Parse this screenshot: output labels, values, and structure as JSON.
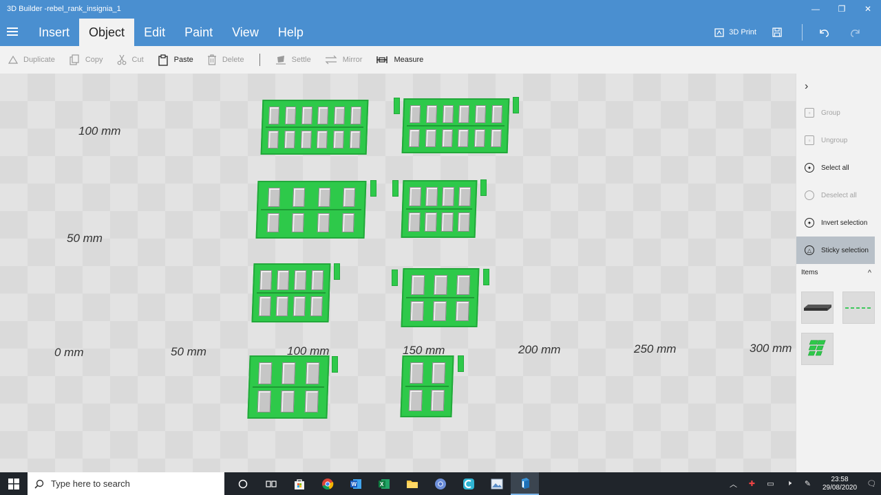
{
  "window": {
    "title": "3D Builder -rebel_rank_insignia_1",
    "minimize": "—",
    "maximize": "❐",
    "close": "✕"
  },
  "menu": {
    "items": [
      "Insert",
      "Object",
      "Edit",
      "Paint",
      "View",
      "Help"
    ],
    "active": "Object"
  },
  "right_tools": {
    "print_label": "3D Print"
  },
  "toolbar": {
    "duplicate": "Duplicate",
    "copy": "Copy",
    "cut": "Cut",
    "paste": "Paste",
    "delete": "Delete",
    "settle": "Settle",
    "mirror": "Mirror",
    "measure": "Measure"
  },
  "viewport": {
    "rulers": [
      "100 mm",
      "50 mm",
      "0 mm",
      "50 mm",
      "100 mm",
      "150 mm",
      "200 mm",
      "250 mm",
      "300 mm"
    ],
    "plate_color": "#2ec94a"
  },
  "panel": {
    "expand": "›",
    "group": "Group",
    "ungroup": "Ungroup",
    "select_all": "Select all",
    "deselect_all": "Deselect all",
    "invert_selection": "Invert selection",
    "sticky_selection": "Sticky selection",
    "items_label": "Items",
    "collapse": "^"
  },
  "taskbar": {
    "search_placeholder": "Type here to search",
    "time": "23:58",
    "date": "29/08/2020"
  },
  "colors": {
    "accent": "#4a8fd0",
    "taskbar": "#20252b",
    "panel": "#f2f2f2"
  }
}
